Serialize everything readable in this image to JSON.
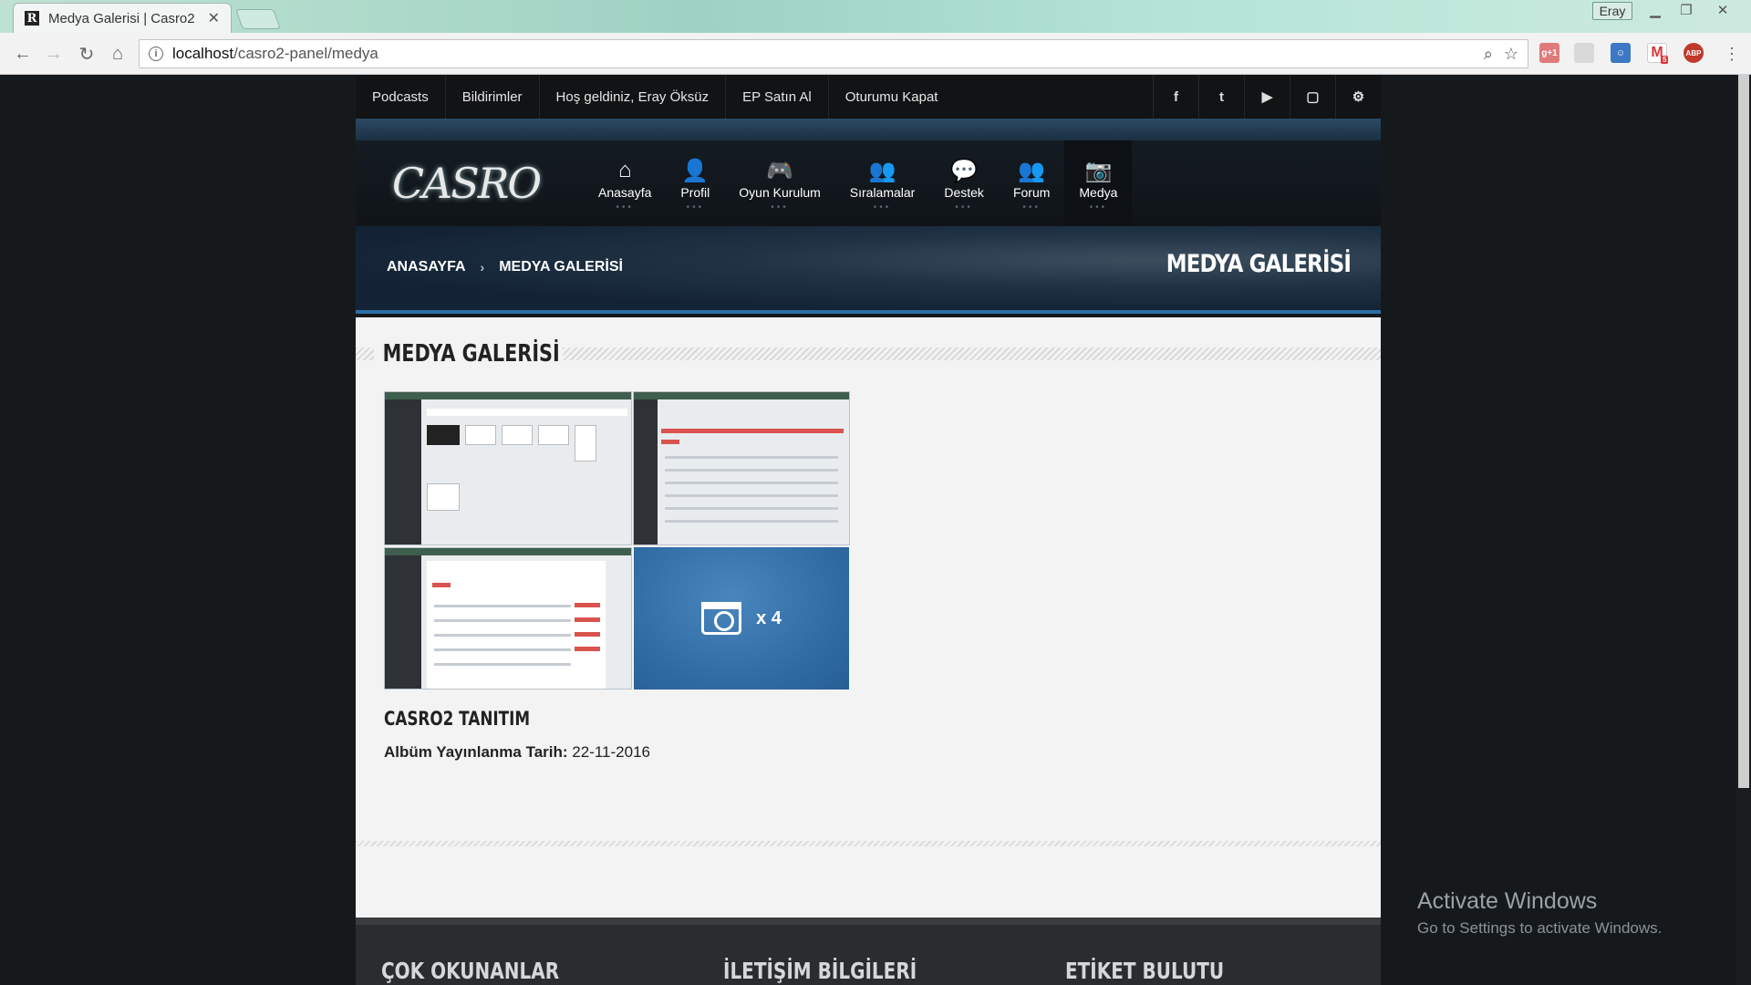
{
  "browser": {
    "tab_title": "Medya Galerisi | Casro2",
    "tab_favicon": "R",
    "profile_name": "Eray",
    "url_host": "localhost",
    "url_path": "/casro2-panel/medya",
    "gmail_badge": "5",
    "abp_label": "ABP",
    "gplus_label": "g+1"
  },
  "topnav": {
    "links": [
      "Podcasts",
      "Bildirimler",
      "Hoş geldiniz, Eray Öksüz",
      "EP Satın Al",
      "Oturumu Kapat"
    ],
    "social_icons": [
      "facebook-icon",
      "twitter-icon",
      "youtube-icon",
      "twitch-icon",
      "steam-icon"
    ],
    "social_glyphs": [
      "f",
      "t",
      "▶",
      "▢",
      "⚙"
    ]
  },
  "logo_text": "CASRO",
  "menu": [
    {
      "label": "Anasayfa",
      "icon": "home-icon",
      "glyph": "⌂"
    },
    {
      "label": "Profil",
      "icon": "user-icon",
      "glyph": "👤"
    },
    {
      "label": "Oyun Kurulum",
      "icon": "gamepad-icon",
      "glyph": "🎮"
    },
    {
      "label": "Sıralamalar",
      "icon": "users-icon",
      "glyph": "👥"
    },
    {
      "label": "Destek",
      "icon": "comments-icon",
      "glyph": "💬"
    },
    {
      "label": "Forum",
      "icon": "group-icon",
      "glyph": "👥"
    },
    {
      "label": "Medya",
      "icon": "camera-icon",
      "glyph": "📷"
    }
  ],
  "breadcrumb": {
    "home": "ANASAYFA",
    "separator": "›",
    "current": "MEDYA GALERİSİ"
  },
  "banner_title": "MEDYA GALERİSİ",
  "section_title": "MEDYA GALERİSİ",
  "album": {
    "more_count": "x 4",
    "title": "CASRO2 TANITIM",
    "date_label": "Albüm Yayınlanma Tarih:",
    "date_value": "22-11-2016"
  },
  "footer": {
    "col1": "ÇOK OKUNANLAR",
    "col2": "İLETİŞİM BİLGİLERİ",
    "col3": "ETİKET BULUTU"
  },
  "os_watermark": {
    "title": "Activate Windows",
    "subtitle": "Go to Settings to activate Windows."
  },
  "colors": {
    "accent": "#2d6ea6",
    "topbar": "#111315",
    "content_bg": "#f3f3f3"
  }
}
